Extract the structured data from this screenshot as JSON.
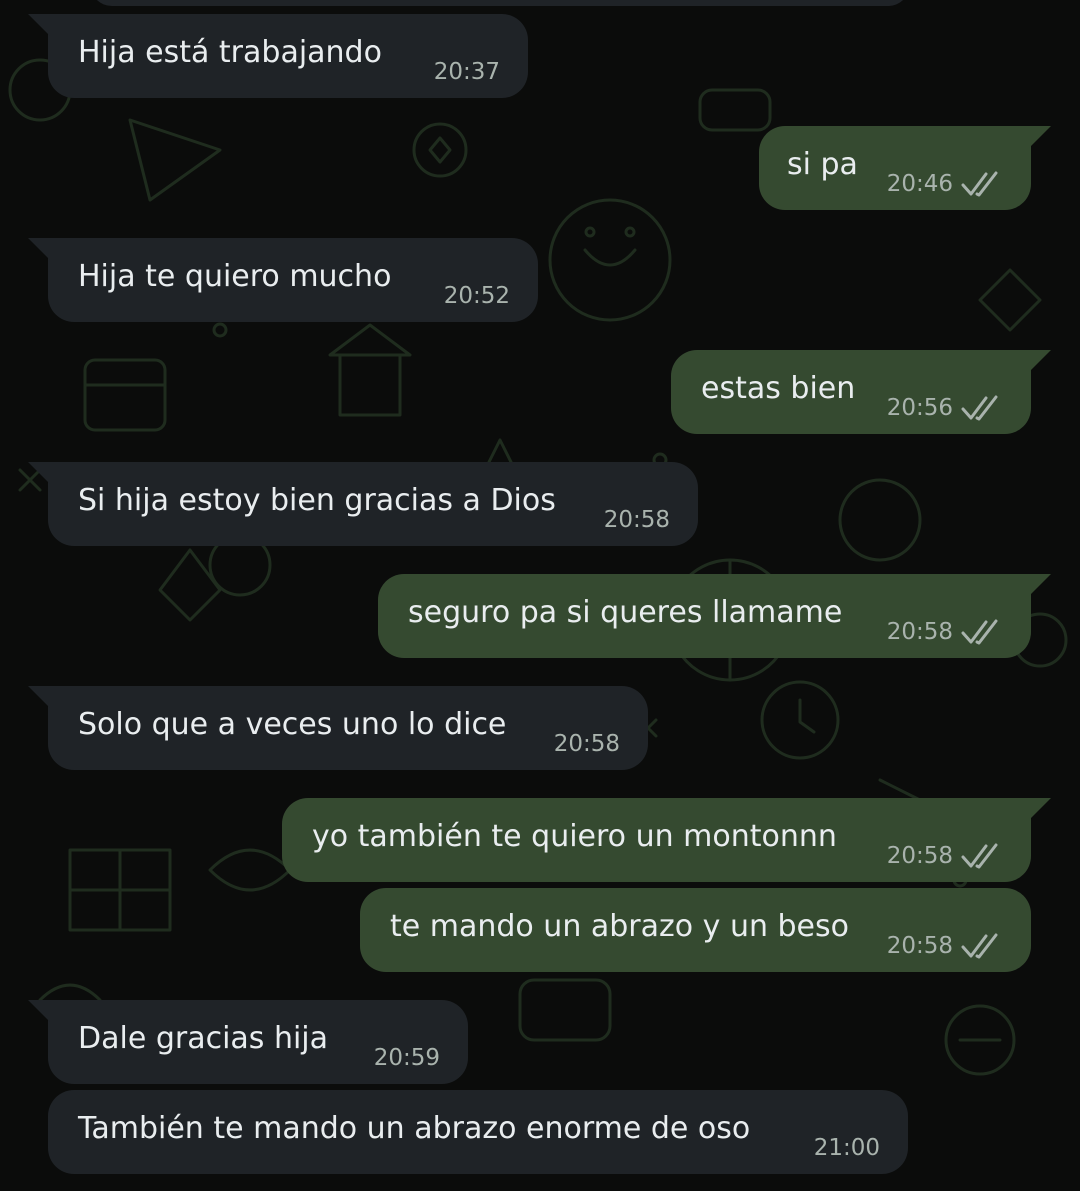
{
  "chat": {
    "messages": [
      {
        "direction": "in",
        "text": "Hija está trabajando",
        "time": "20:37",
        "ticks": false
      },
      {
        "direction": "out",
        "text": "si pa",
        "time": "20:46",
        "ticks": true,
        "tick_state": "delivered"
      },
      {
        "direction": "in",
        "text": "Hija te quiero mucho",
        "time": "20:52",
        "ticks": false
      },
      {
        "direction": "out",
        "text": "estas bien",
        "time": "20:56",
        "ticks": true,
        "tick_state": "delivered"
      },
      {
        "direction": "in",
        "text": "Si hija estoy bien gracias a Dios",
        "time": "20:58",
        "ticks": false
      },
      {
        "direction": "out",
        "text": "seguro pa si queres llamame",
        "time": "20:58",
        "ticks": true,
        "tick_state": "delivered"
      },
      {
        "direction": "in",
        "text": "Solo que a veces uno lo dice",
        "time": "20:58",
        "ticks": false
      },
      {
        "direction": "out",
        "text": "yo también te quiero un montonnn",
        "time": "20:58",
        "ticks": true,
        "tick_state": "delivered"
      },
      {
        "direction": "out",
        "text": "te mando un abrazo y un beso",
        "time": "20:58",
        "ticks": true,
        "tick_state": "delivered"
      },
      {
        "direction": "in",
        "text": "Dale gracias hija",
        "time": "20:59",
        "ticks": false
      },
      {
        "direction": "in",
        "text": "También te mando un abrazo enorme de oso",
        "time": "21:00",
        "ticks": false
      }
    ]
  },
  "colors": {
    "background": "#0b0c0b",
    "incoming_bubble": "#1f2327",
    "outgoing_bubble": "#354a30",
    "message_text": "#e9edef",
    "timestamp_text": "#a9b3ad",
    "delivered_tick": "#a9b3ad",
    "wallpaper_doodle": "#1d2a1c"
  },
  "icons": {
    "delivery_status": "double-check-icon",
    "wallpaper": "doodle-pattern"
  }
}
